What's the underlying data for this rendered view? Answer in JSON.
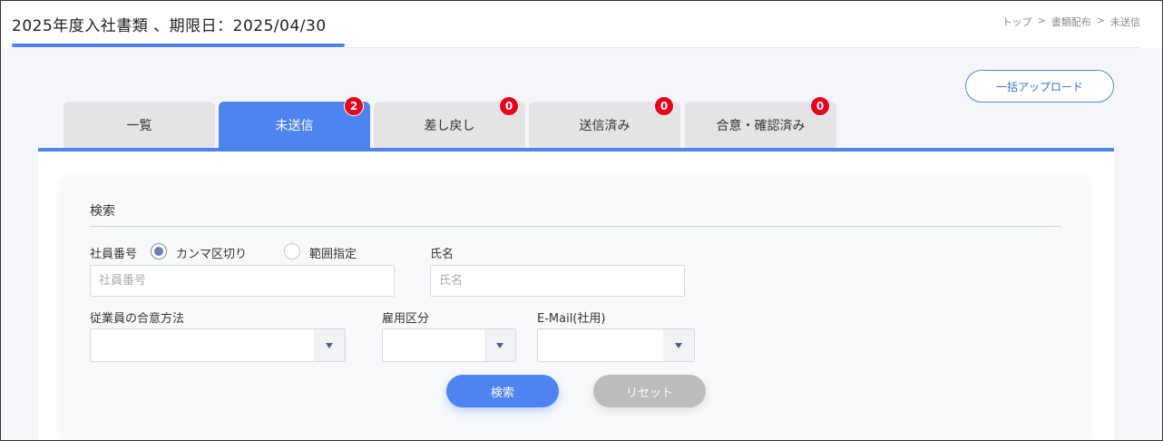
{
  "header": {
    "title": "2025年度入社書類 、期限日：2025/04/30",
    "breadcrumb": [
      "トップ",
      ">",
      "書類配布",
      ">",
      "未送信"
    ]
  },
  "toolbar": {
    "bulk_upload_label": "一括アップロード"
  },
  "tabs": [
    {
      "label": "一覧",
      "badge": null,
      "active": false
    },
    {
      "label": "未送信",
      "badge": "2",
      "active": true
    },
    {
      "label": "差し戻し",
      "badge": "0",
      "active": false
    },
    {
      "label": "送信済み",
      "badge": "0",
      "active": false
    },
    {
      "label": "合意・確認済み",
      "badge": "0",
      "active": false
    }
  ],
  "search": {
    "heading": "検索",
    "employee_number": {
      "label": "社員番号",
      "mode_options": [
        "カンマ区切り",
        "範囲指定"
      ],
      "selected_mode": "カンマ区切り",
      "placeholder": "社員番号",
      "value": ""
    },
    "name": {
      "label": "氏名",
      "placeholder": "氏名",
      "value": ""
    },
    "agreement_method": {
      "label": "従業員の合意方法",
      "value": ""
    },
    "employment_type": {
      "label": "雇用区分",
      "value": ""
    },
    "email": {
      "label": "E-Mail(社用)",
      "value": ""
    },
    "search_button": "検索",
    "reset_button": "リセット"
  },
  "colors": {
    "accent": "#4f84f0",
    "badge": "#e8001c",
    "tab_inactive": "#e4e4e4",
    "reset_button": "#bcbcbc"
  }
}
